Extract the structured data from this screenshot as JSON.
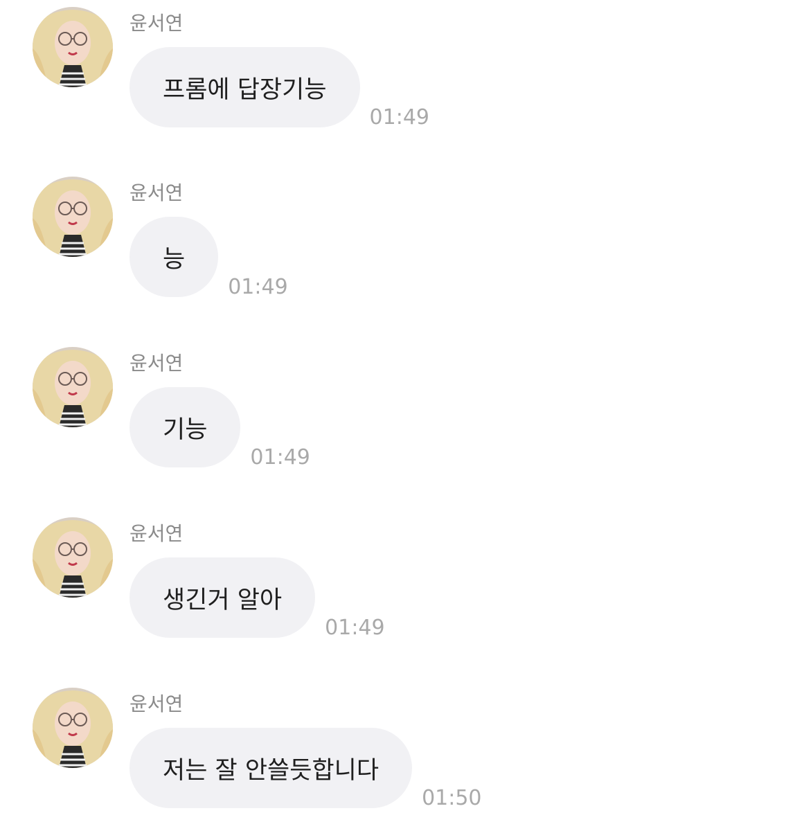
{
  "chat": {
    "messages": [
      {
        "sender": "윤서연",
        "text": "프롬에 답장기능",
        "time": "01:49",
        "avatar_icon": "profile-photo-icon"
      },
      {
        "sender": "윤서연",
        "text": "능",
        "time": "01:49",
        "avatar_icon": "profile-photo-icon"
      },
      {
        "sender": "윤서연",
        "text": "기능",
        "time": "01:49",
        "avatar_icon": "profile-photo-icon"
      },
      {
        "sender": "윤서연",
        "text": "생긴거 알아",
        "time": "01:49",
        "avatar_icon": "profile-photo-icon"
      },
      {
        "sender": "윤서연",
        "text": "저는 잘 안쓸듯합니다",
        "time": "01:50",
        "avatar_icon": "profile-photo-icon"
      }
    ]
  },
  "colors": {
    "background": "#ffffff",
    "bubble": "#f1f1f4",
    "message_text": "#1f1f1f",
    "sender_text": "#8a8a8a",
    "time_text": "#a9a9a9"
  }
}
